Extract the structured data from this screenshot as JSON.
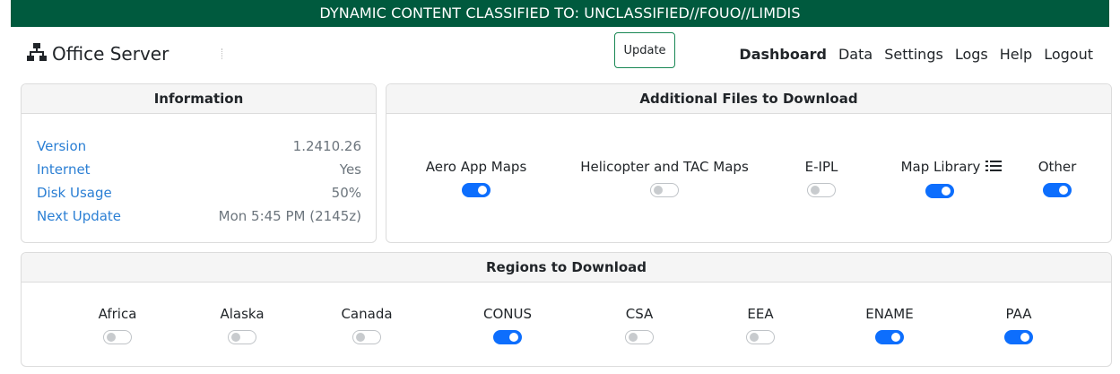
{
  "banner": {
    "text": "DYNAMIC CONTENT CLASSIFIED TO: UNCLASSIFIED//FOUO//LIMDIS"
  },
  "navbar": {
    "brand": "Office Server",
    "update_label": "Update",
    "links": [
      {
        "label": "Dashboard",
        "active": true
      },
      {
        "label": "Data",
        "active": false
      },
      {
        "label": "Settings",
        "active": false
      },
      {
        "label": "Logs",
        "active": false
      },
      {
        "label": "Help",
        "active": false
      },
      {
        "label": "Logout",
        "active": false
      }
    ]
  },
  "information": {
    "title": "Information",
    "rows": [
      {
        "label": "Version",
        "value": "1.2410.26"
      },
      {
        "label": "Internet",
        "value": "Yes"
      },
      {
        "label": "Disk Usage",
        "value": "50%"
      },
      {
        "label": "Next Update",
        "value": "Mon 5:45 PM (2145z)"
      }
    ]
  },
  "files": {
    "title": "Additional Files to Download",
    "items": [
      {
        "label": "Aero App Maps",
        "enabled": true
      },
      {
        "label": "Helicopter and TAC Maps",
        "enabled": false
      },
      {
        "label": "E-IPL",
        "enabled": false
      },
      {
        "label": "Map Library",
        "enabled": true,
        "icon": "list-icon"
      },
      {
        "label": "Other",
        "enabled": true
      }
    ]
  },
  "regions": {
    "title": "Regions to Download",
    "items": [
      {
        "label": "Africa",
        "enabled": false
      },
      {
        "label": "Alaska",
        "enabled": false
      },
      {
        "label": "Canada",
        "enabled": false
      },
      {
        "label": "CONUS",
        "enabled": true
      },
      {
        "label": "CSA",
        "enabled": false
      },
      {
        "label": "EEA",
        "enabled": false
      },
      {
        "label": "ENAME",
        "enabled": true
      },
      {
        "label": "PAA",
        "enabled": true
      }
    ]
  },
  "colors": {
    "banner_bg": "#005a3e",
    "toggle_on": "#0d6efd",
    "link_blue": "#2b7fd4",
    "update_border": "#198754"
  }
}
